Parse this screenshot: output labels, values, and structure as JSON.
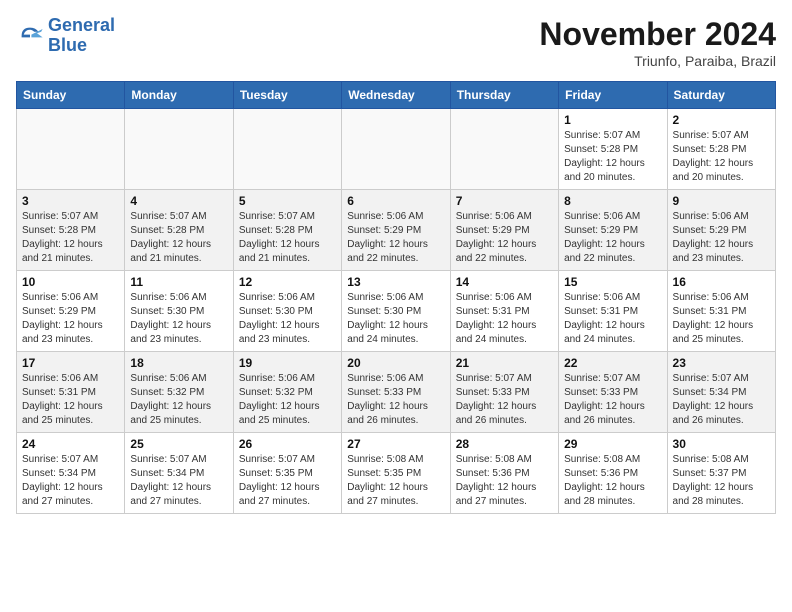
{
  "logo": {
    "line1": "General",
    "line2": "Blue"
  },
  "title": "November 2024",
  "subtitle": "Triunfo, Paraiba, Brazil",
  "weekdays": [
    "Sunday",
    "Monday",
    "Tuesday",
    "Wednesday",
    "Thursday",
    "Friday",
    "Saturday"
  ],
  "weeks": [
    [
      {
        "day": "",
        "info": ""
      },
      {
        "day": "",
        "info": ""
      },
      {
        "day": "",
        "info": ""
      },
      {
        "day": "",
        "info": ""
      },
      {
        "day": "",
        "info": ""
      },
      {
        "day": "1",
        "info": "Sunrise: 5:07 AM\nSunset: 5:28 PM\nDaylight: 12 hours\nand 20 minutes."
      },
      {
        "day": "2",
        "info": "Sunrise: 5:07 AM\nSunset: 5:28 PM\nDaylight: 12 hours\nand 20 minutes."
      }
    ],
    [
      {
        "day": "3",
        "info": "Sunrise: 5:07 AM\nSunset: 5:28 PM\nDaylight: 12 hours\nand 21 minutes."
      },
      {
        "day": "4",
        "info": "Sunrise: 5:07 AM\nSunset: 5:28 PM\nDaylight: 12 hours\nand 21 minutes."
      },
      {
        "day": "5",
        "info": "Sunrise: 5:07 AM\nSunset: 5:28 PM\nDaylight: 12 hours\nand 21 minutes."
      },
      {
        "day": "6",
        "info": "Sunrise: 5:06 AM\nSunset: 5:29 PM\nDaylight: 12 hours\nand 22 minutes."
      },
      {
        "day": "7",
        "info": "Sunrise: 5:06 AM\nSunset: 5:29 PM\nDaylight: 12 hours\nand 22 minutes."
      },
      {
        "day": "8",
        "info": "Sunrise: 5:06 AM\nSunset: 5:29 PM\nDaylight: 12 hours\nand 22 minutes."
      },
      {
        "day": "9",
        "info": "Sunrise: 5:06 AM\nSunset: 5:29 PM\nDaylight: 12 hours\nand 23 minutes."
      }
    ],
    [
      {
        "day": "10",
        "info": "Sunrise: 5:06 AM\nSunset: 5:29 PM\nDaylight: 12 hours\nand 23 minutes."
      },
      {
        "day": "11",
        "info": "Sunrise: 5:06 AM\nSunset: 5:30 PM\nDaylight: 12 hours\nand 23 minutes."
      },
      {
        "day": "12",
        "info": "Sunrise: 5:06 AM\nSunset: 5:30 PM\nDaylight: 12 hours\nand 23 minutes."
      },
      {
        "day": "13",
        "info": "Sunrise: 5:06 AM\nSunset: 5:30 PM\nDaylight: 12 hours\nand 24 minutes."
      },
      {
        "day": "14",
        "info": "Sunrise: 5:06 AM\nSunset: 5:31 PM\nDaylight: 12 hours\nand 24 minutes."
      },
      {
        "day": "15",
        "info": "Sunrise: 5:06 AM\nSunset: 5:31 PM\nDaylight: 12 hours\nand 24 minutes."
      },
      {
        "day": "16",
        "info": "Sunrise: 5:06 AM\nSunset: 5:31 PM\nDaylight: 12 hours\nand 25 minutes."
      }
    ],
    [
      {
        "day": "17",
        "info": "Sunrise: 5:06 AM\nSunset: 5:31 PM\nDaylight: 12 hours\nand 25 minutes."
      },
      {
        "day": "18",
        "info": "Sunrise: 5:06 AM\nSunset: 5:32 PM\nDaylight: 12 hours\nand 25 minutes."
      },
      {
        "day": "19",
        "info": "Sunrise: 5:06 AM\nSunset: 5:32 PM\nDaylight: 12 hours\nand 25 minutes."
      },
      {
        "day": "20",
        "info": "Sunrise: 5:06 AM\nSunset: 5:33 PM\nDaylight: 12 hours\nand 26 minutes."
      },
      {
        "day": "21",
        "info": "Sunrise: 5:07 AM\nSunset: 5:33 PM\nDaylight: 12 hours\nand 26 minutes."
      },
      {
        "day": "22",
        "info": "Sunrise: 5:07 AM\nSunset: 5:33 PM\nDaylight: 12 hours\nand 26 minutes."
      },
      {
        "day": "23",
        "info": "Sunrise: 5:07 AM\nSunset: 5:34 PM\nDaylight: 12 hours\nand 26 minutes."
      }
    ],
    [
      {
        "day": "24",
        "info": "Sunrise: 5:07 AM\nSunset: 5:34 PM\nDaylight: 12 hours\nand 27 minutes."
      },
      {
        "day": "25",
        "info": "Sunrise: 5:07 AM\nSunset: 5:34 PM\nDaylight: 12 hours\nand 27 minutes."
      },
      {
        "day": "26",
        "info": "Sunrise: 5:07 AM\nSunset: 5:35 PM\nDaylight: 12 hours\nand 27 minutes."
      },
      {
        "day": "27",
        "info": "Sunrise: 5:08 AM\nSunset: 5:35 PM\nDaylight: 12 hours\nand 27 minutes."
      },
      {
        "day": "28",
        "info": "Sunrise: 5:08 AM\nSunset: 5:36 PM\nDaylight: 12 hours\nand 27 minutes."
      },
      {
        "day": "29",
        "info": "Sunrise: 5:08 AM\nSunset: 5:36 PM\nDaylight: 12 hours\nand 28 minutes."
      },
      {
        "day": "30",
        "info": "Sunrise: 5:08 AM\nSunset: 5:37 PM\nDaylight: 12 hours\nand 28 minutes."
      }
    ]
  ]
}
